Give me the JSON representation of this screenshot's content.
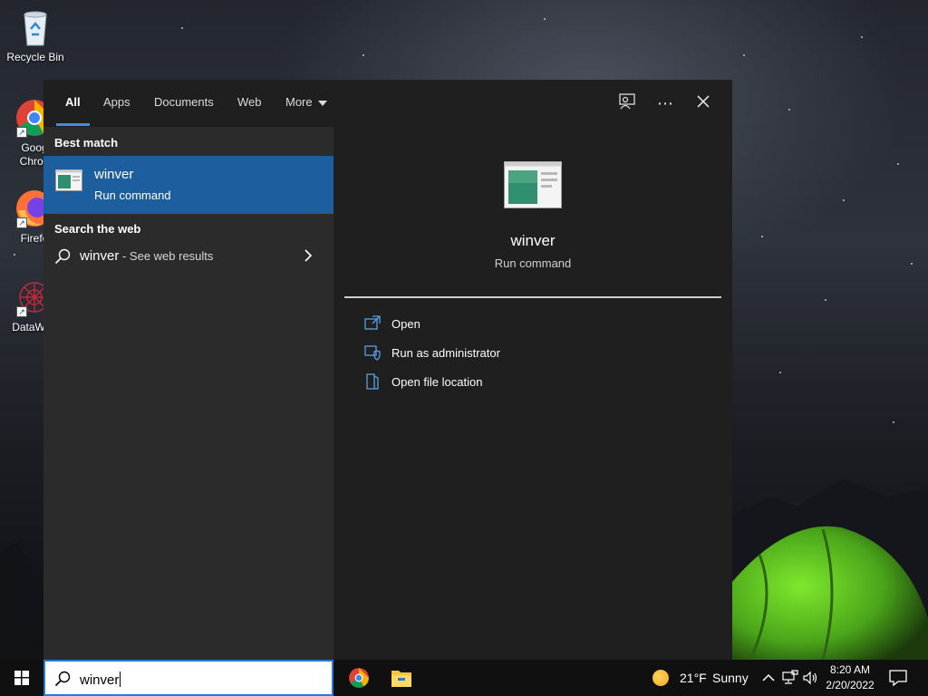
{
  "desktop": {
    "icons": [
      {
        "label": "Recycle Bin"
      },
      {
        "label": "Goog Chron"
      },
      {
        "label": "Firefo"
      },
      {
        "label": "DataWag"
      }
    ]
  },
  "search": {
    "tabs": [
      {
        "label": "All"
      },
      {
        "label": "Apps"
      },
      {
        "label": "Documents"
      },
      {
        "label": "Web"
      },
      {
        "label": "More"
      }
    ],
    "best_match_heading": "Best match",
    "best_match": {
      "name": "winver",
      "type": "Run command"
    },
    "search_web_heading": "Search the web",
    "web_result": {
      "query": "winver",
      "suffix": " - See web results"
    },
    "preview": {
      "name": "winver",
      "type": "Run command",
      "actions": [
        {
          "label": "Open",
          "icon": "open-icon"
        },
        {
          "label": "Run as administrator",
          "icon": "shield-icon"
        },
        {
          "label": "Open file location",
          "icon": "folder-location-icon"
        }
      ]
    },
    "query": "winver"
  },
  "taskbar": {
    "weather": {
      "temp": "21°F",
      "condition": "Sunny"
    },
    "clock": {
      "time": "8:20 AM",
      "date": "2/20/2022"
    }
  },
  "colors": {
    "accent": "#1d5e9e",
    "tab_underline": "#3a8ee6",
    "panel_bg": "#1f1f1f",
    "left_pane_bg": "#2b2b2b",
    "taskbar_bg": "#101010"
  }
}
